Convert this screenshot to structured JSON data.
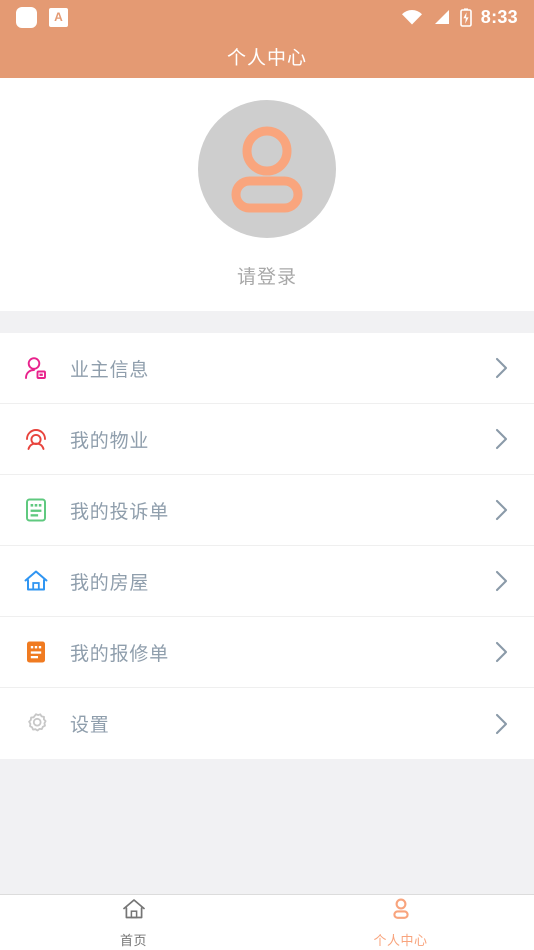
{
  "statusbar": {
    "time": "8:33",
    "left_icons": [
      "app-notification-icon",
      "a-badge-icon"
    ],
    "a_badge_text": "A",
    "right_icons": [
      "wifi-icon",
      "cellular-signal-icon",
      "battery-charging-icon"
    ]
  },
  "header": {
    "title": "个人中心",
    "background_color": "#e49a73"
  },
  "profile": {
    "avatar_icon": "user-avatar-placeholder-icon",
    "avatar_bg_color": "#cecece",
    "avatar_icon_color": "#f9a57d",
    "login_prompt": "请登录"
  },
  "menu": {
    "items": [
      {
        "label": "业主信息",
        "icon": "owner-id-person-icon",
        "color": "#e8228c"
      },
      {
        "label": "我的物业",
        "icon": "property-service-person-icon",
        "color": "#e8433c"
      },
      {
        "label": "我的投诉单",
        "icon": "complaint-form-icon",
        "color": "#5fc97f"
      },
      {
        "label": "我的房屋",
        "icon": "house-icon",
        "color": "#2f95f2"
      },
      {
        "label": "我的报修单",
        "icon": "repair-order-icon",
        "color": "#f07b21"
      },
      {
        "label": "设置",
        "icon": "gear-icon",
        "color": "#c7c7c7"
      }
    ],
    "chevron_icon": "chevron-right-icon",
    "chevron_color": "#8a9aa8",
    "label_color": "#8f9eac"
  },
  "tabbar": {
    "tabs": [
      {
        "label": "首页",
        "icon": "home-icon",
        "active": false
      },
      {
        "label": "个人中心",
        "icon": "person-icon",
        "active": true
      }
    ],
    "active_color": "#f8a47d",
    "inactive_color": "#757575"
  }
}
